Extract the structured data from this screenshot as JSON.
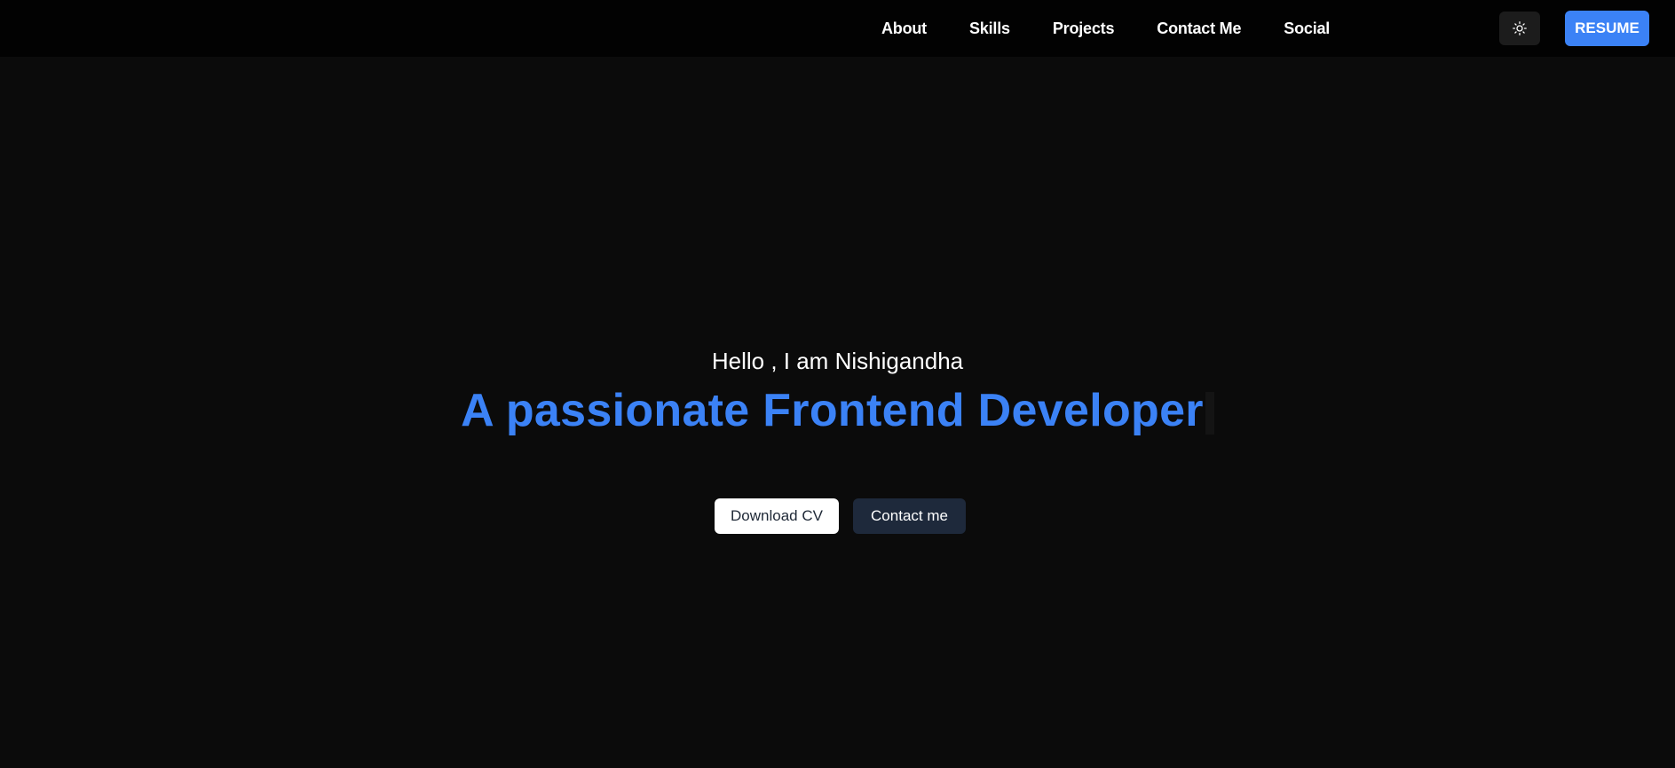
{
  "nav": {
    "items": [
      {
        "label": "About"
      },
      {
        "label": "Skills"
      },
      {
        "label": "Projects"
      },
      {
        "label": "Contact Me"
      },
      {
        "label": "Social"
      }
    ],
    "theme_icon": "sun-icon",
    "resume_label": "RESUME"
  },
  "hero": {
    "greeting": "Hello , I am Nishigandha",
    "headline": "A passionate Frontend Developer",
    "download_label": "Download CV",
    "contact_label": "Contact me"
  },
  "colors": {
    "background": "#0b0b0b",
    "navbar": "#020202",
    "accent": "#3b82f6",
    "contact_button": "#1e293b"
  }
}
